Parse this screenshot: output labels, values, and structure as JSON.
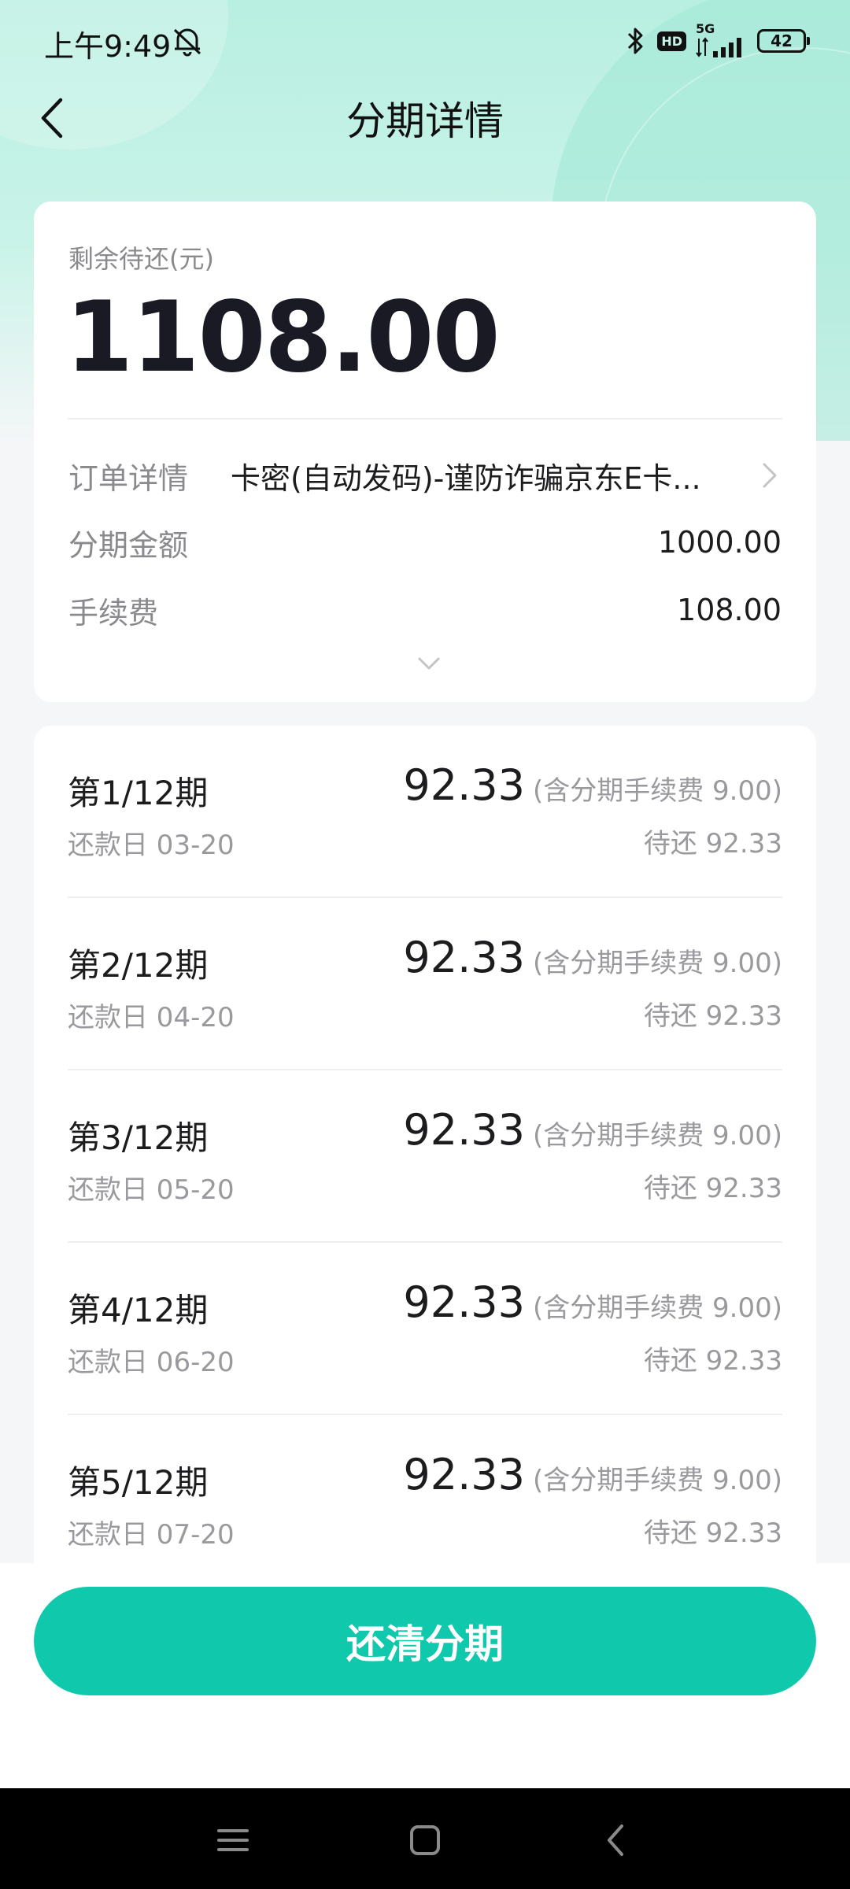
{
  "status_bar": {
    "time": "上午9:49",
    "hd": "HD",
    "network": "5G",
    "battery": "42"
  },
  "nav": {
    "title": "分期详情",
    "back_icon": "chevron-left-icon"
  },
  "summary": {
    "remaining_label": "剩余待还(元)",
    "remaining_amount": "1108.00",
    "order_label": "订单详情",
    "order_value": "卡密(自动发码)-谨防诈骗京东E卡...",
    "installment_amount_label": "分期金额",
    "installment_amount": "1000.00",
    "fee_label": "手续费",
    "fee": "108.00"
  },
  "installments": [
    {
      "period": "第1/12期",
      "due_date": "还款日 03-20",
      "amount": "92.33",
      "fee_note": "(含分期手续费 9.00)",
      "pending": "待还 92.33"
    },
    {
      "period": "第2/12期",
      "due_date": "还款日 04-20",
      "amount": "92.33",
      "fee_note": "(含分期手续费 9.00)",
      "pending": "待还 92.33"
    },
    {
      "period": "第3/12期",
      "due_date": "还款日 05-20",
      "amount": "92.33",
      "fee_note": "(含分期手续费 9.00)",
      "pending": "待还 92.33"
    },
    {
      "period": "第4/12期",
      "due_date": "还款日 06-20",
      "amount": "92.33",
      "fee_note": "(含分期手续费 9.00)",
      "pending": "待还 92.33"
    },
    {
      "period": "第5/12期",
      "due_date": "还款日 07-20",
      "amount": "92.33",
      "fee_note": "(含分期手续费 9.00)",
      "pending": "待还 92.33"
    }
  ],
  "footer": {
    "pay_off_label": "还清分期"
  },
  "colors": {
    "accent": "#10c9ad",
    "header_bg": "#b8efe1"
  }
}
